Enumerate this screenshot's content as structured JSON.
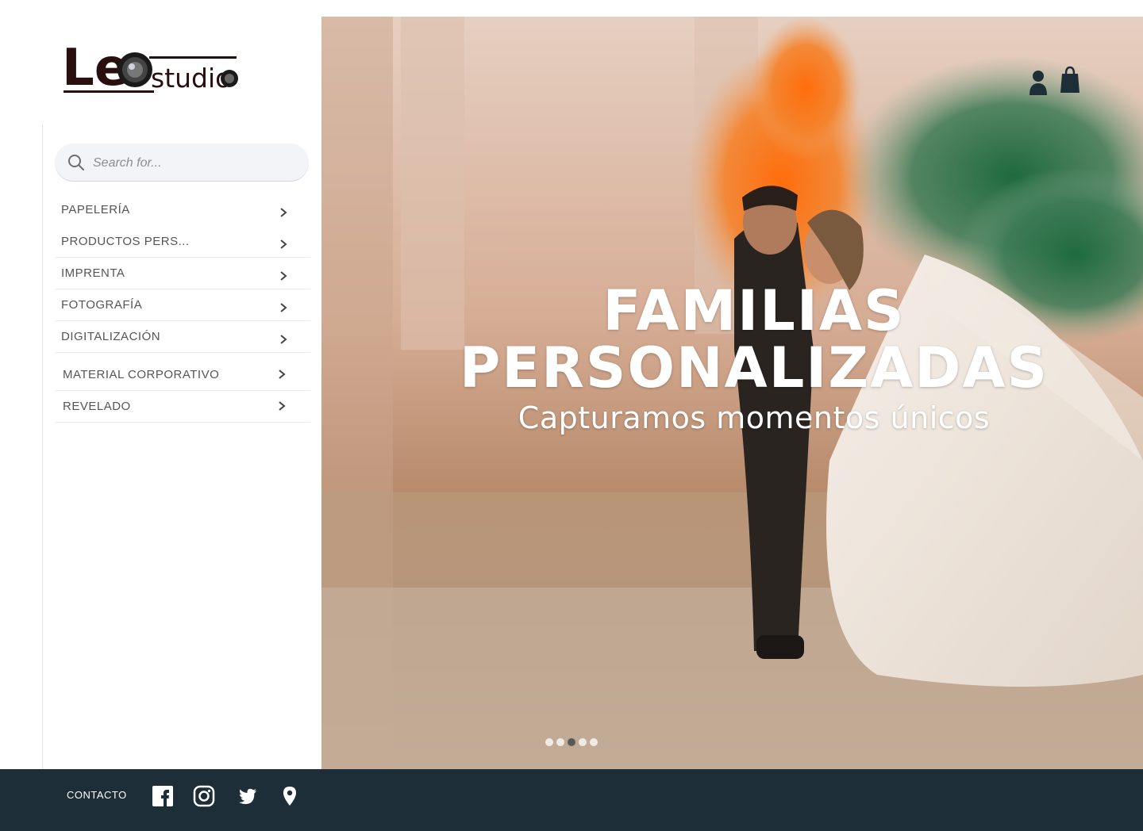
{
  "brand": {
    "logo_text_left": "Le",
    "logo_text_right": "studio"
  },
  "search": {
    "placeholder": "Search for..."
  },
  "sidebar": {
    "items": [
      {
        "label": "PAPELERÍA"
      },
      {
        "label": "PRODUCTOS PERS..."
      },
      {
        "label": "IMPRENTA"
      },
      {
        "label": "FOTOGRAFÍA"
      },
      {
        "label": "DIGITALIZACIÓN"
      },
      {
        "label": "MATERIAL CORPORATIVO"
      },
      {
        "label": "REVELADO"
      }
    ]
  },
  "hero": {
    "title_line1": "FAMILIAS",
    "title_line2": "PERSONALIZADAS",
    "subtitle": "Capturamos momentos únicos",
    "slide_count": 5,
    "active_slide": 3
  },
  "footer": {
    "contact_label": "CONTACTO",
    "social_icons": [
      "facebook-icon",
      "instagram-icon",
      "twitter-icon",
      "location-pin-icon"
    ]
  },
  "colors": {
    "footer_bg": "#1d2e38",
    "accent_orange": "#f07a1e",
    "accent_green": "#2c6b45"
  }
}
